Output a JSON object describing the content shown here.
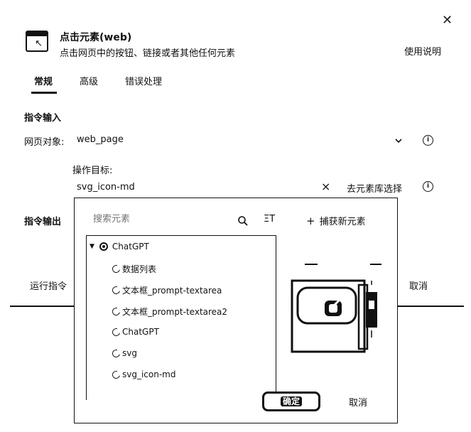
{
  "header": {
    "title": "点击元素(web)",
    "subtitle": "点击网页中的按钮、链接或者其他任何元素",
    "help": "使用说明",
    "close": "✕"
  },
  "tabs": [
    {
      "label": "常规",
      "active": true
    },
    {
      "label": "高级",
      "active": false
    },
    {
      "label": "错误处理",
      "active": false
    }
  ],
  "input_section": {
    "heading": "指令输入",
    "web_object_label": "网页对象:",
    "web_object_value": "web_page",
    "target_label": "操作目标:",
    "target_value": "svg_icon-md",
    "clear": "×",
    "library_button": "去元素库选择"
  },
  "output_section": {
    "heading": "指令输出"
  },
  "footer": {
    "run": "运行指令",
    "cancel": "取消"
  },
  "popup": {
    "search_placeholder": "搜索元素",
    "sort": "ΞΤ",
    "capture_label": "捕获新元素",
    "capture_icon": "+",
    "tree": {
      "root": "ChatGPT",
      "items": [
        "数据列表",
        "文本框_prompt-textarea",
        "文本框_prompt-textarea2",
        "ChatGPT",
        "svg",
        "svg_icon-md"
      ]
    },
    "confirm": "确定",
    "cancel": "取消"
  }
}
